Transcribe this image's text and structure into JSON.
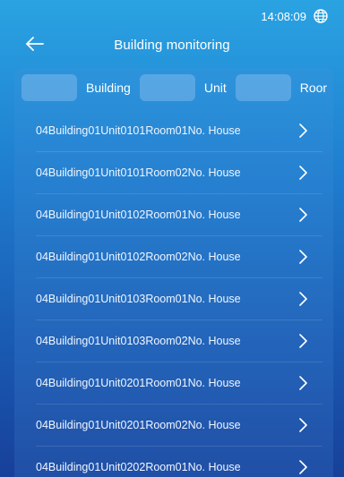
{
  "status": {
    "time": "14:08:09",
    "icon": "globe-icon"
  },
  "header": {
    "title": "Building monitoring",
    "back_icon": "back-arrow-icon"
  },
  "filters": [
    {
      "label": "Building"
    },
    {
      "label": "Unit"
    },
    {
      "label": "Roor"
    }
  ],
  "rows": [
    "04Building01Unit0101Room01No. House",
    "04Building01Unit0101Room02No. House",
    "04Building01Unit0102Room01No. House",
    "04Building01Unit0102Room02No. House",
    "04Building01Unit0103Room01No. House",
    "04Building01Unit0103Room02No. House",
    "04Building01Unit0201Room01No. House",
    "04Building01Unit0201Room02No. House",
    "04Building01Unit0202Room01No. House"
  ]
}
